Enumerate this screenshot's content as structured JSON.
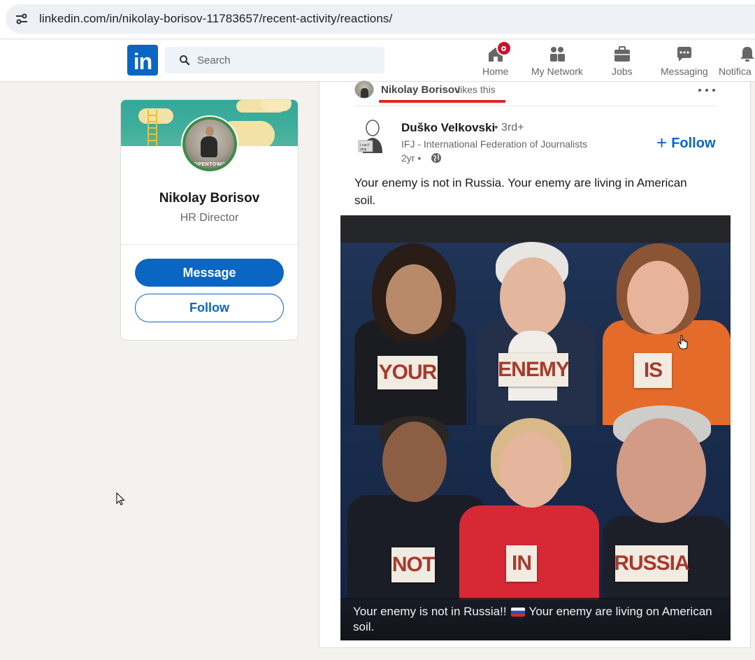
{
  "browser": {
    "url": "linkedin.com/in/nikolay-borisov-11783657/recent-activity/reactions/"
  },
  "nav": {
    "search_placeholder": "Search",
    "items": [
      {
        "label": "Home",
        "icon": "home-icon"
      },
      {
        "label": "My Network",
        "icon": "network-icon"
      },
      {
        "label": "Jobs",
        "icon": "briefcase-icon"
      },
      {
        "label": "Messaging",
        "icon": "messaging-icon"
      },
      {
        "label": "Notifica",
        "icon": "bell-icon"
      }
    ]
  },
  "profile": {
    "name": "Nikolay Borisov",
    "title": "HR Director",
    "avatar_badge": "#OPENTOWORK",
    "message_label": "Message",
    "follow_label": "Follow"
  },
  "activity": {
    "actor": "Nikolay Borisov",
    "action": "likes this"
  },
  "post": {
    "author": "Duško Velkovski",
    "degree": "• 3rd+",
    "headline": "IFJ - International Federation of Journalists",
    "time": "2yr •",
    "follow_label": "Follow",
    "text": "Your enemy is not in Russia. Your enemy are living in American soil.",
    "image": {
      "signs": [
        "YOUR",
        "ENEMY",
        "IS",
        "NOT",
        "IN",
        "RUSSIA"
      ],
      "caption_part1": "Your enemy is not in Russia!!",
      "caption_part2": "Your enemy are living on American soil."
    }
  },
  "colors": {
    "linkedin_blue": "#0a66c2",
    "notification_red": "#cb112d",
    "highlight_red": "#e02626",
    "page_bg": "#f3f2ef"
  }
}
